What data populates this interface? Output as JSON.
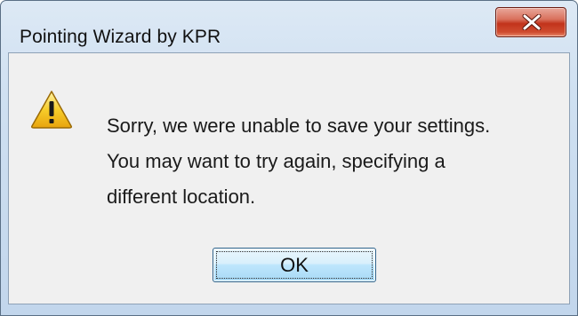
{
  "window": {
    "title": "Pointing Wizard by KPR"
  },
  "titlebar": {
    "close_icon": "close-icon"
  },
  "dialog": {
    "icon": "warning-icon",
    "message_lines": [
      "Sorry, we were unable to save your settings.",
      "You may want to try again, specifying a",
      "different location."
    ],
    "ok_label": "OK"
  },
  "colors": {
    "client_background": "#f0f0f0",
    "close_button_red": "#c2331b",
    "ok_button_blue": "#bee6fd",
    "warning_yellow": "#f7cd2a"
  }
}
